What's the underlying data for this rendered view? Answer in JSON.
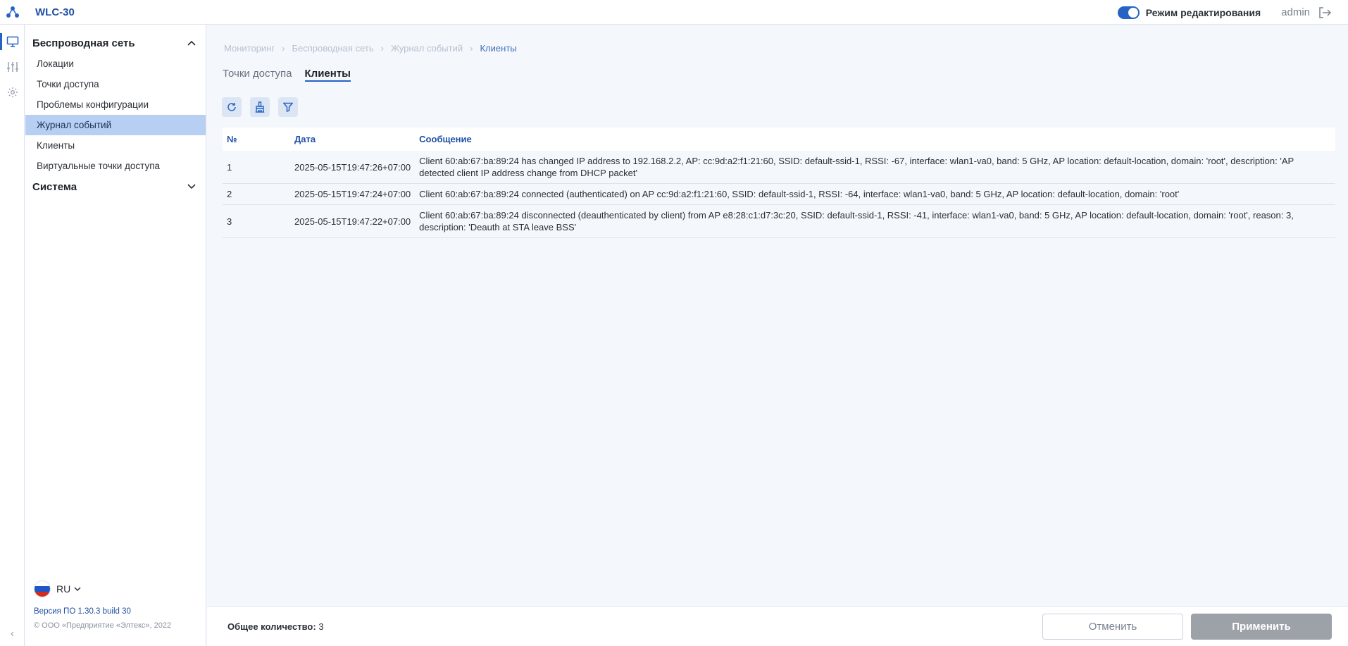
{
  "app": {
    "title": "WLC-30"
  },
  "topbar": {
    "edit_mode_label": "Режим редактирования",
    "user": "admin"
  },
  "sidebar": {
    "sections": [
      {
        "title": "Беспроводная сеть",
        "expanded": true,
        "items": [
          {
            "label": "Локации",
            "active": false
          },
          {
            "label": "Точки доступа",
            "active": false
          },
          {
            "label": "Проблемы конфигурации",
            "active": false
          },
          {
            "label": "Журнал событий",
            "active": true
          },
          {
            "label": "Клиенты",
            "active": false
          },
          {
            "label": "Виртуальные точки доступа",
            "active": false
          }
        ]
      },
      {
        "title": "Система",
        "expanded": false
      }
    ],
    "language": "RU",
    "version": "Версия ПО 1.30.3 build 30",
    "copyright": "© ООО «Предприятие «Элтекс», 2022"
  },
  "breadcrumb": [
    "Мониторинг",
    "Беспроводная сеть",
    "Журнал событий",
    "Клиенты"
  ],
  "tabs": [
    {
      "label": "Точки доступа",
      "active": false
    },
    {
      "label": "Клиенты",
      "active": true
    }
  ],
  "toolbar": {
    "icons": [
      "refresh-icon",
      "clear-icon",
      "filter-icon"
    ]
  },
  "table": {
    "headers": [
      "№",
      "Дата",
      "Сообщение"
    ],
    "rows": [
      {
        "n": "1",
        "date": "2025-05-15T19:47:26+07:00",
        "message": "Client 60:ab:67:ba:89:24 has changed IP address to 192.168.2.2, AP: cc:9d:a2:f1:21:60, SSID: default-ssid-1, RSSI: -67, interface: wlan1-va0, band: 5 GHz, AP location: default-location, domain: 'root', description: 'AP detected client IP address change from DHCP packet'"
      },
      {
        "n": "2",
        "date": "2025-05-15T19:47:24+07:00",
        "message": "Client 60:ab:67:ba:89:24 connected (authenticated) on AP cc:9d:a2:f1:21:60, SSID: default-ssid-1, RSSI: -64, interface: wlan1-va0, band: 5 GHz, AP location: default-location, domain: 'root'"
      },
      {
        "n": "3",
        "date": "2025-05-15T19:47:22+07:00",
        "message": "Client 60:ab:67:ba:89:24 disconnected (deauthenticated by client) from AP e8:28:c1:d7:3c:20, SSID: default-ssid-1, RSSI: -41, interface: wlan1-va0, band: 5 GHz, AP location: default-location, domain: 'root', reason: 3, description: 'Deauth at STA leave BSS'"
      }
    ]
  },
  "footer": {
    "total_label": "Общее количество:",
    "total_value": "3",
    "cancel_label": "Отменить",
    "apply_label": "Применить"
  },
  "colors": {
    "accent": "#2563c5",
    "active_nav": "#b7cff3",
    "apply_disabled": "#9da2a9"
  }
}
